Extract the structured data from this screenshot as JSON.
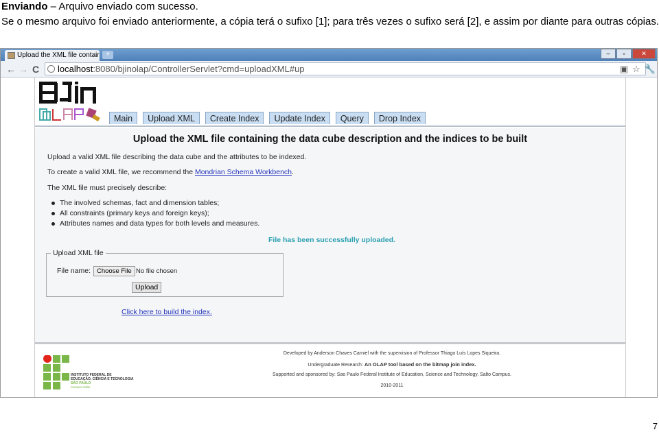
{
  "document": {
    "heading_bold": "Enviando",
    "heading_rest": " – Arquivo enviado com sucesso.",
    "paragraph": "Se o mesmo arquivo foi enviado anteriormente, a cópia terá o sufixo [1]; para três vezes o sufixo será [2], e assim por diante para outras cópias.",
    "page_number": "7"
  },
  "browser": {
    "tab_title": "Upload the XML file contair",
    "url_host": "localhost",
    "url_rest": ":8080/bjinolap/ControllerServlet?cmd=uploadXML#up"
  },
  "app": {
    "logo_text": "BJin OLAP",
    "nav": [
      "Main",
      "Upload XML",
      "Create Index",
      "Update Index",
      "Query",
      "Drop Index"
    ],
    "title": "Upload the XML file containing the data cube description and the indices to be built",
    "intro": "Upload a valid XML file describing the data cube and the attributes to be indexed.",
    "recommend_prefix": "To create a valid XML file, we recommend the ",
    "recommend_link": "Mondrian Schema Workbench",
    "recommend_suffix": ".",
    "must_describe": "The XML file must precisely describe:",
    "bullets": [
      "The involved schemas, fact and dimension tables;",
      "All constraints (primary keys and foreign keys);",
      "Attributes names and data types for both levels and measures."
    ],
    "success": "File has been successfully uploaded.",
    "upload_form": {
      "legend": "Upload XML file",
      "file_label": "File name:",
      "choose_button": "Choose File",
      "no_file": "No file chosen",
      "upload_button": "Upload"
    },
    "build_link": "Click here to build the index."
  },
  "footer": {
    "developed": "Developed by Anderson Chaves Carniel with the supervision of Professor Thiago Luís Lopes Siqueira.",
    "research_prefix": "Undergraduate Research: ",
    "research_title": "An OLAP tool based on the bitmap join index.",
    "supported": "Supported and sponsored by: Sao Paulo Federal Institute of Education, Science and Technology. Salto Campus.",
    "years": "2010-2011",
    "ifsp_logo_text": "INSTITUTO FEDERAL DE EDUCAÇÃO, CIÊNCIA E TECNOLOGIA SÃO PAULO Campus Salto"
  },
  "colors": {
    "tab_bg": "#c9def3",
    "success": "#2aa0b0",
    "link": "#2233bb",
    "ifsp_green": "#7ab648",
    "ifsp_red": "#e1251b"
  }
}
